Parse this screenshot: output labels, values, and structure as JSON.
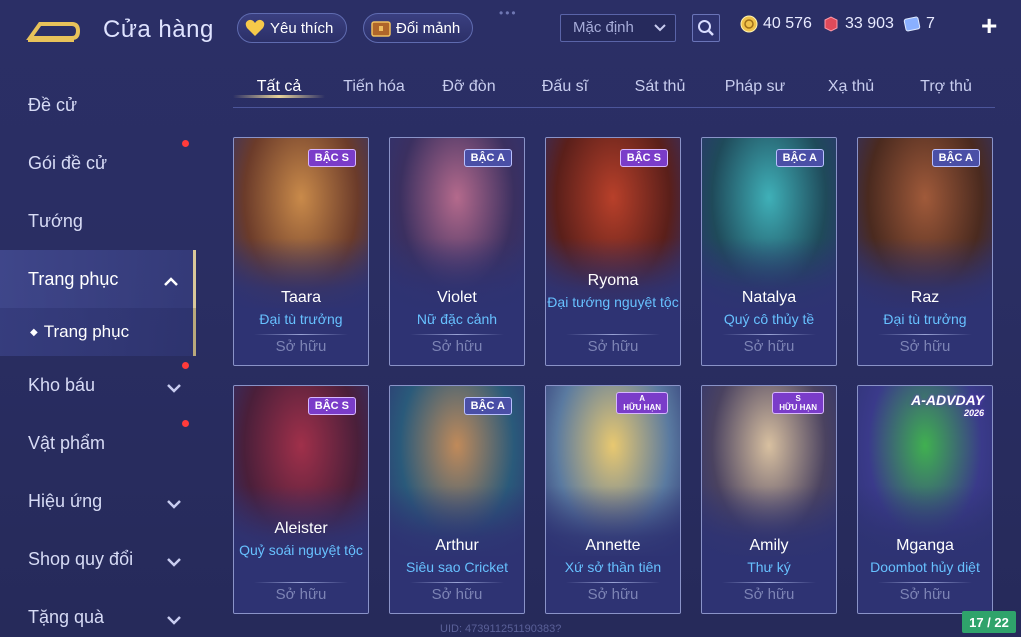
{
  "header": {
    "title": "Cửa hàng",
    "favorites_label": "Yêu thích",
    "exchange_label": "Đổi mảnh",
    "sort_value": "Mặc định",
    "currencies": [
      {
        "icon": "gold-coin-icon",
        "value": "40 576"
      },
      {
        "icon": "ruby-icon",
        "value": "33 903"
      },
      {
        "icon": "voucher-icon",
        "value": "7"
      }
    ],
    "plus": "+"
  },
  "sidebar": {
    "items": [
      {
        "label": "Đề cử"
      },
      {
        "label": "Gói đề cử"
      },
      {
        "label": "Tướng"
      },
      {
        "label": "Trang phục"
      },
      {
        "label": "Kho báu"
      },
      {
        "label": "Vật phẩm"
      },
      {
        "label": "Hiệu ứng"
      },
      {
        "label": "Shop quy đổi"
      },
      {
        "label": "Tặng quà"
      }
    ],
    "sub_item": "Trang phục"
  },
  "tabs": [
    "Tất cả",
    "Tiến hóa",
    "Đỡ đòn",
    "Đấu sĩ",
    "Sát thủ",
    "Pháp sư",
    "Xạ thủ",
    "Trợ thủ"
  ],
  "cards": [
    {
      "name": "Taara",
      "skin": "Đại tù trưởng",
      "tier": "BẬC S",
      "status": "Sở hữu",
      "colors": [
        "#6b3b2a",
        "#c98a4a"
      ]
    },
    {
      "name": "Violet",
      "skin": "Nữ đặc cảnh",
      "tier": "BẬC A",
      "status": "Sở hữu",
      "colors": [
        "#3b3060",
        "#b46a8c"
      ]
    },
    {
      "name": "Ryoma",
      "skin": "Đại tướng nguyệt tộc",
      "tier": "BẬC S",
      "status": "Sở hữu",
      "colors": [
        "#5a1f1a",
        "#b8402a"
      ]
    },
    {
      "name": "Natalya",
      "skin": "Quý cô thủy tề",
      "tier": "BẬC A",
      "status": "Sở hữu",
      "colors": [
        "#1f4a5a",
        "#3fb0b8"
      ]
    },
    {
      "name": "Raz",
      "skin": "Đại tù trưởng",
      "tier": "BẬC A",
      "status": "Sở hữu",
      "colors": [
        "#4a2a1f",
        "#a05a3a"
      ]
    },
    {
      "name": "Aleister",
      "skin": "Quỷ soái nguyệt tộc",
      "tier": "BẬC S",
      "status": "Sở hữu",
      "colors": [
        "#4a1f3a",
        "#a0304a"
      ]
    },
    {
      "name": "Arthur",
      "skin": "Siêu sao Cricket",
      "tier": "BẬC A",
      "status": "Sở hữu",
      "colors": [
        "#2a5a7a",
        "#c08a5a"
      ]
    },
    {
      "name": "Annette",
      "skin": "Xứ sở thần tiên",
      "tier_line1": "A",
      "tier_line2": "HỮU HẠN",
      "status": "Sở hữu",
      "colors": [
        "#5a7aa0",
        "#e8c870"
      ]
    },
    {
      "name": "Amily",
      "skin": "Thư ký",
      "tier_line1": "S",
      "tier_line2": "HỮU HẠN",
      "status": "Sở hữu",
      "colors": [
        "#4a4260",
        "#d8c0a0"
      ]
    },
    {
      "name": "Mganga",
      "skin": "Doombot hủy diệt",
      "banner": "A-ADVDAY",
      "banner_year": "2026",
      "status": "Sở hữu",
      "colors": [
        "#3a3a8a",
        "#40b050"
      ]
    }
  ],
  "pager": "17 / 22",
  "uid": "UID: 473911251190383?"
}
